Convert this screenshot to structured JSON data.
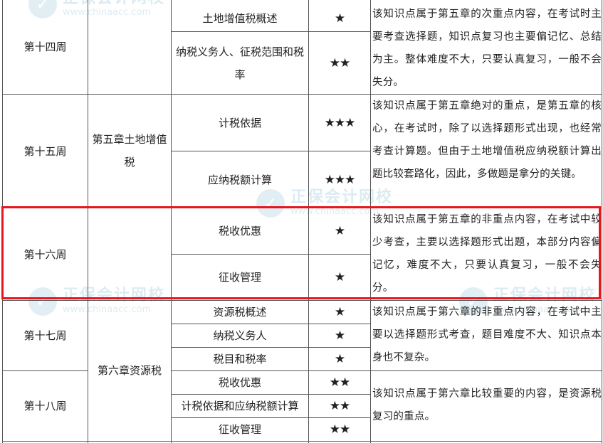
{
  "rows": [
    {
      "week": "第十四周",
      "items": [
        {
          "topic": "土地增值税概述",
          "stars": "★"
        },
        {
          "topic": "纳税义务人、征税范围和税率",
          "stars": "★★"
        }
      ],
      "description": "该知识点属于第五章的次重点内容，在考试时主要考查选择题，知识点复习也主要偏记忆、总结为主。整体难度不大，只要认真复习，一般不会失分。"
    },
    {
      "week": "第十五周",
      "items": [
        {
          "topic": "计税依据",
          "stars": "★★★"
        },
        {
          "topic": "应纳税额计算",
          "stars": "★★★"
        }
      ],
      "description": "该知识点属于第五章绝对的重点，是第五章的核心，在考试时，除了以选择题形式出现，也经常考查计算题。但由于土地增值税应纳税额计算出题比较套路化，因此，多做题是拿分的关键。"
    },
    {
      "week": "第十六周",
      "items": [
        {
          "topic": "税收优惠",
          "stars": "★"
        },
        {
          "topic": "征收管理",
          "stars": "★"
        }
      ],
      "description": "该知识点属于第五章的非重点内容，在考试中较少考查，主要以选择题形式出题，本部分内容偏记忆，难度不大，只要认真复习，一般不会失分。"
    },
    {
      "week": "第十七周",
      "items": [
        {
          "topic": "资源税概述",
          "stars": "★"
        },
        {
          "topic": "纳税义务人",
          "stars": "★"
        },
        {
          "topic": "税目和税率",
          "stars": "★"
        }
      ],
      "description": "该知识点属于第六章的非重点内容，在考试中主要以选择题形式考查，题目难度不大、知识点本身也不复杂。"
    },
    {
      "week": "第十八周",
      "items": [
        {
          "topic": "税收优惠",
          "stars": "★★"
        },
        {
          "topic": "计税依据和应纳税额计算",
          "stars": "★★"
        },
        {
          "topic": "征收管理",
          "stars": "★★"
        }
      ],
      "description": "该知识点属于第六章比较重要的内容，是资源税复习的重点。"
    }
  ],
  "chapters": [
    "第五章土地增值税",
    "第六章资源税"
  ],
  "watermark": {
    "brand": "正保会计网校",
    "url": "www.chinaacc.com"
  },
  "highlight_color": "#e8141e"
}
